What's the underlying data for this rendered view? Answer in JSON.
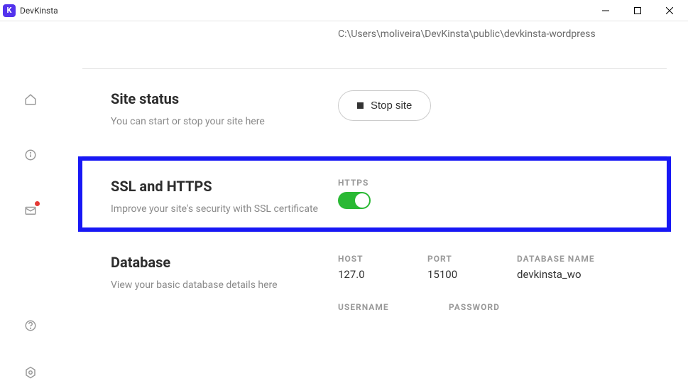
{
  "window": {
    "title": "DevKinsta",
    "icon_letter": "K"
  },
  "path": "C:\\Users\\moliveira\\DevKinsta\\public\\devkinsta-wordpress",
  "sections": {
    "site_status": {
      "title": "Site status",
      "subtitle": "You can start or stop your site here",
      "button": "Stop site"
    },
    "ssl": {
      "title": "SSL and HTTPS",
      "subtitle": "Improve your site's security with SSL certificate",
      "toggle_label": "HTTPS",
      "toggle_on": true
    },
    "database": {
      "title": "Database",
      "subtitle": "View your basic database details here",
      "fields": {
        "host_label": "HOST",
        "host_value": "127.0",
        "port_label": "PORT",
        "port_value": "15100",
        "dbname_label": "DATABASE NAME",
        "dbname_value": "devkinsta_wo",
        "username_label": "USERNAME",
        "password_label": "PASSWORD"
      }
    }
  }
}
